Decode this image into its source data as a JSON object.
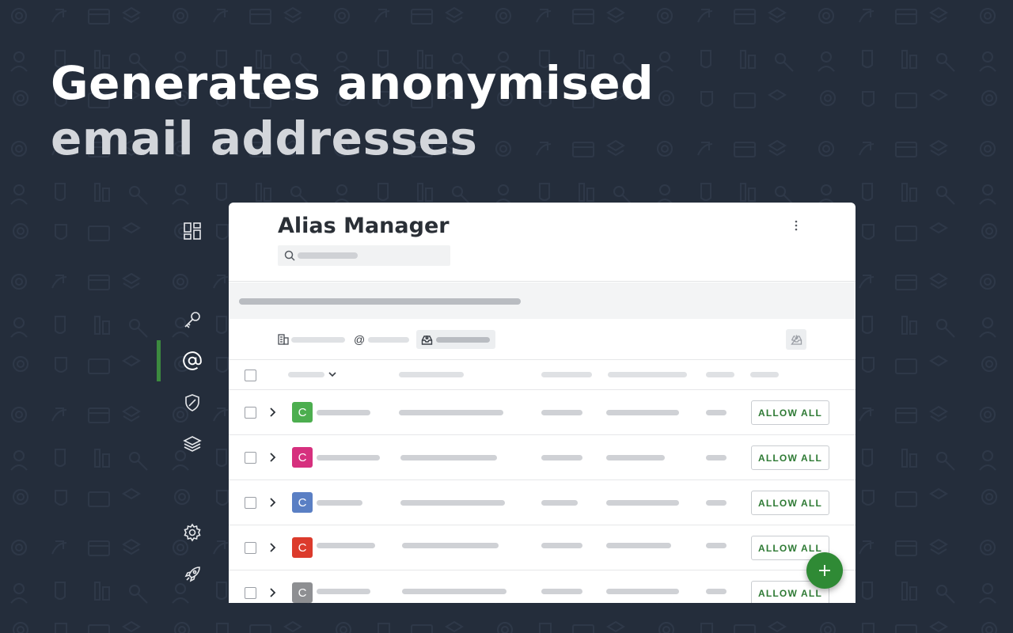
{
  "headline": {
    "line1": "Generates anonymised",
    "line2": "email addresses"
  },
  "sidebar": {
    "items": [
      {
        "icon": "dashboard-icon"
      },
      {
        "icon": "key-icon"
      },
      {
        "icon": "at-sign-icon",
        "active": true
      },
      {
        "icon": "shield-icon"
      },
      {
        "icon": "layers-icon"
      },
      {
        "icon": "gear-icon"
      },
      {
        "icon": "rocket-icon"
      }
    ],
    "active_color": "#3c8a3f"
  },
  "panel": {
    "title": "Alias Manager",
    "menu_icon": "kebab-menu-icon",
    "search_icon": "search-icon"
  },
  "tabs": {
    "at_label": "@",
    "icons": [
      "building-icon",
      "at-sign-icon",
      "inbox-icon"
    ],
    "export_icon": "inbox-download-icon"
  },
  "rows": [
    {
      "initial": "C",
      "color": "#4cae4f",
      "button": "ALLOW ALL"
    },
    {
      "initial": "C",
      "color": "#d6307e",
      "button": "ALLOW ALL"
    },
    {
      "initial": "C",
      "color": "#5a7fc4",
      "button": "ALLOW ALL"
    },
    {
      "initial": "C",
      "color": "#dc3b2c",
      "button": "ALLOW ALL"
    },
    {
      "initial": "C",
      "color": "#8e8f92",
      "button": "ALLOW ALL"
    }
  ],
  "fab": {
    "icon": "plus-icon",
    "color": "#2f8a35"
  }
}
